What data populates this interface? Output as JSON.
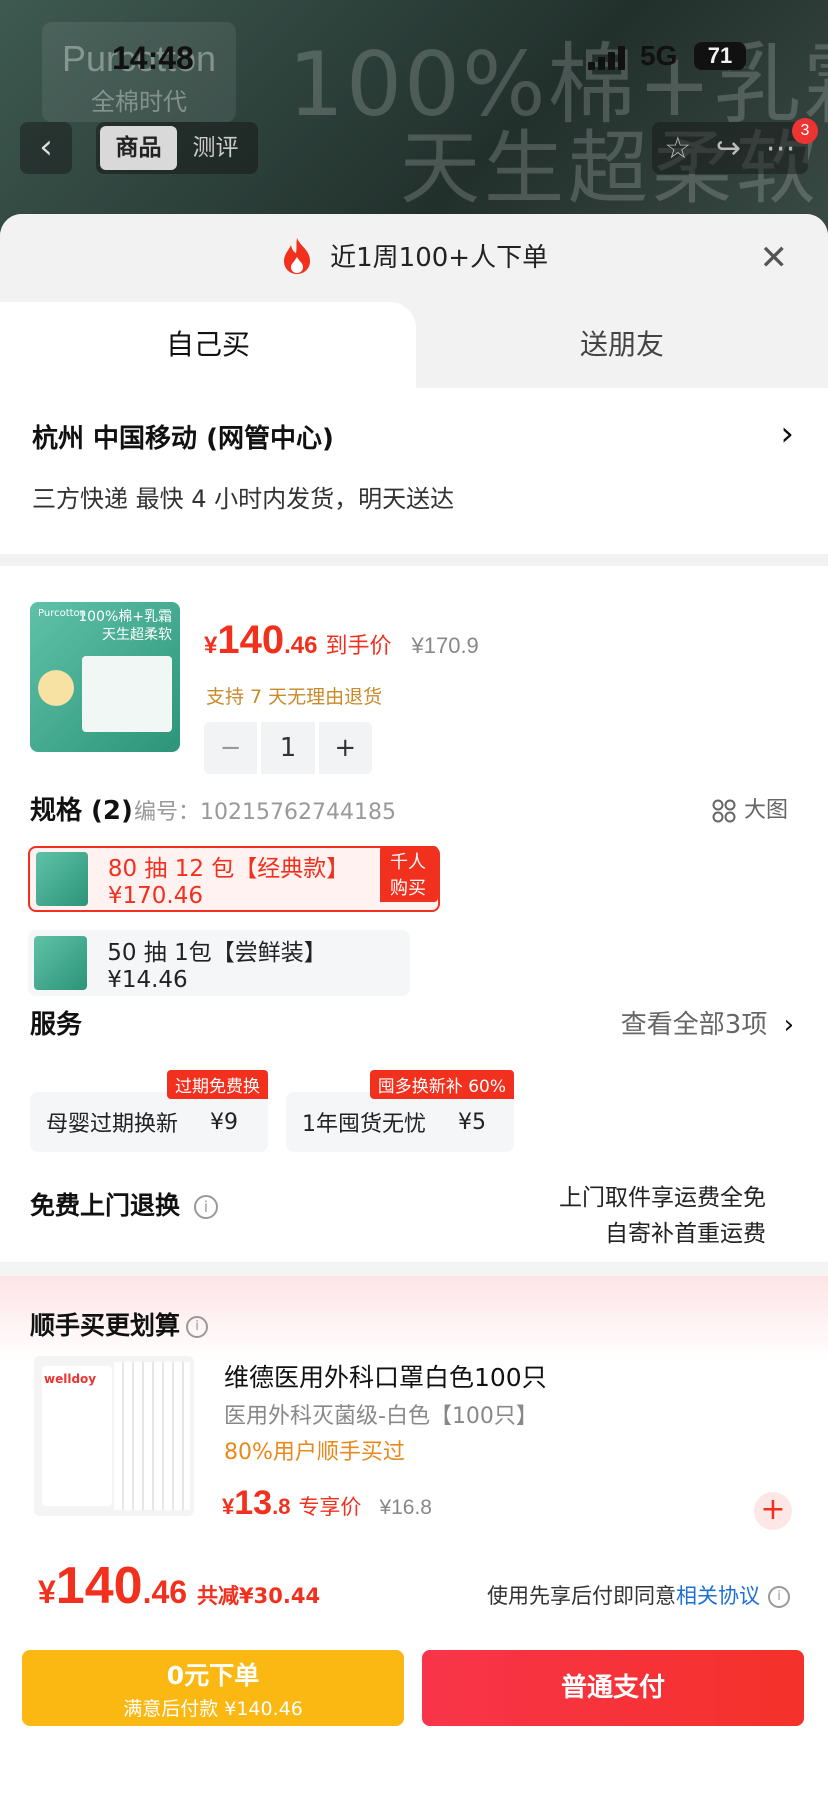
{
  "status_bar": {
    "time": "14:48",
    "network": "5G",
    "battery": "71"
  },
  "background": {
    "logo_line1": "Purcotton",
    "logo_line2": "全棉时代",
    "headline1": "100%棉+乳霜",
    "headline2": "天生超柔软"
  },
  "top_nav": {
    "tab_goods": "商品",
    "tab_review": "测评",
    "cart_badge": "3"
  },
  "sheet": {
    "header_text": "近1周100+人下单",
    "tab_self": "自己买",
    "tab_gift": "送朋友",
    "address": "杭州  中国移动 (网管中心)",
    "delivery": "三方快递 最快 4 小时内发货，明天送达"
  },
  "product": {
    "img_text_top1": "100%棉+乳霜",
    "img_text_top2": "天生超柔软",
    "img_brand": "Purcotton",
    "price_currency": "¥",
    "price_int": "140",
    "price_dec": ".46",
    "price_label": "到手价",
    "orig_price": "¥170.9",
    "return_policy": "支持 7 天无理由退货",
    "quantity": "1"
  },
  "spec": {
    "title": "规格 (2)",
    "code": "编号：10215762744185",
    "big_image": "大图",
    "options": [
      {
        "label": "80 抽 12 包【经典款】 ¥170.46",
        "tag": "千人购买",
        "selected": true
      },
      {
        "label": "50 抽 1包【尝鲜装】 ¥14.46",
        "tag": "",
        "selected": false
      }
    ]
  },
  "services": {
    "title": "服务",
    "view_all": "查看全部3项",
    "items": [
      {
        "name": "母婴过期换新",
        "price": "¥9",
        "tag": "过期免费换"
      },
      {
        "name": "1年囤货无忧",
        "price": "¥5",
        "tag": "囤多换新补 60%"
      }
    ]
  },
  "free_return": {
    "title": "免费上门退换",
    "line1": "上门取件享运费全免",
    "line2": "自寄补首重运费"
  },
  "bundle": {
    "title": "顺手买更划算",
    "img_brand": "welldoy",
    "name": "维德医用外科口罩白色100只",
    "sub": "医用外科灭菌级-白色【100只】",
    "popularity": "80%用户顺手买过",
    "price_currency": "¥",
    "price_int": "13",
    "price_dec": ".8",
    "price_label": "专享价",
    "orig_price": "¥16.8"
  },
  "footer": {
    "currency": "¥",
    "total_int": "140",
    "total_dec": ".46",
    "save": "共减¥30.44",
    "agree_text": "使用先享后付即同意",
    "agree_link": "相关协议",
    "btn_zero_main": "0元下单",
    "btn_zero_sub": "满意后付款 ¥140.46",
    "btn_pay": "普通支付"
  },
  "colors": {
    "accent_red": "#f2301e",
    "gold": "#fbb813",
    "link_blue": "#1d6fd8"
  }
}
